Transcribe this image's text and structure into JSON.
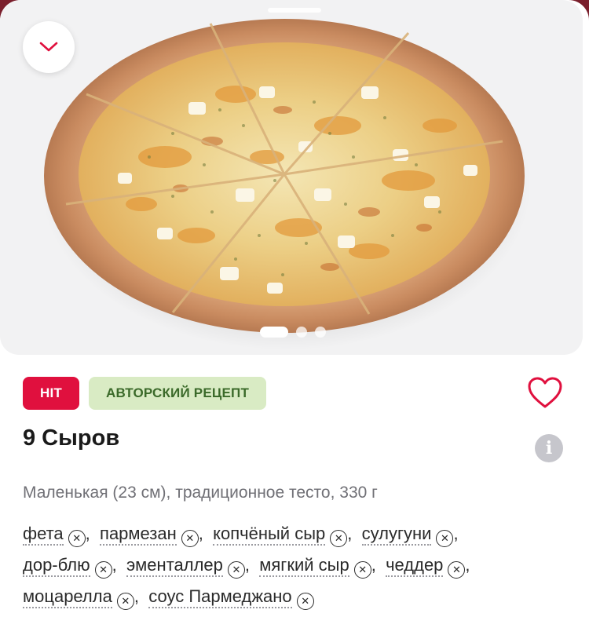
{
  "product": {
    "title": "9 Сыров",
    "description": "Маленькая (23 см), традиционное тесто, 330 г",
    "badges": {
      "hit": "HIT",
      "recipe": "АВТОРСКИЙ РЕЦЕПТ"
    }
  },
  "ingredients": [
    {
      "name": "фета",
      "sep": ", "
    },
    {
      "name": "пармезан",
      "sep": ", "
    },
    {
      "name": "копчёный сыр",
      "sep": ", "
    },
    {
      "name": "сулугуни",
      "sep": ","
    },
    {
      "name": "дор-блю",
      "sep": ", "
    },
    {
      "name": "эменталлер",
      "sep": ", "
    },
    {
      "name": "мягкий сыр",
      "sep": ", "
    },
    {
      "name": "чеддер",
      "sep": ","
    },
    {
      "name": "моцарелла",
      "sep": ", "
    },
    {
      "name": "соус Пармеджано",
      "sep": ""
    }
  ],
  "carousel": {
    "count": 3,
    "active": 0
  },
  "icons": {
    "collapse": "chevron-down-icon",
    "favorite": "heart-icon",
    "info": "info-icon",
    "remove": "remove-circle-icon"
  },
  "info_glyph": "i",
  "remove_glyph": "✕",
  "colors": {
    "accent": "#e0103e",
    "hit_bg": "#e0103e",
    "recipe_bg": "#d9ebc4",
    "recipe_text": "#3b6a2a",
    "backdrop": "#7a1f2c"
  }
}
